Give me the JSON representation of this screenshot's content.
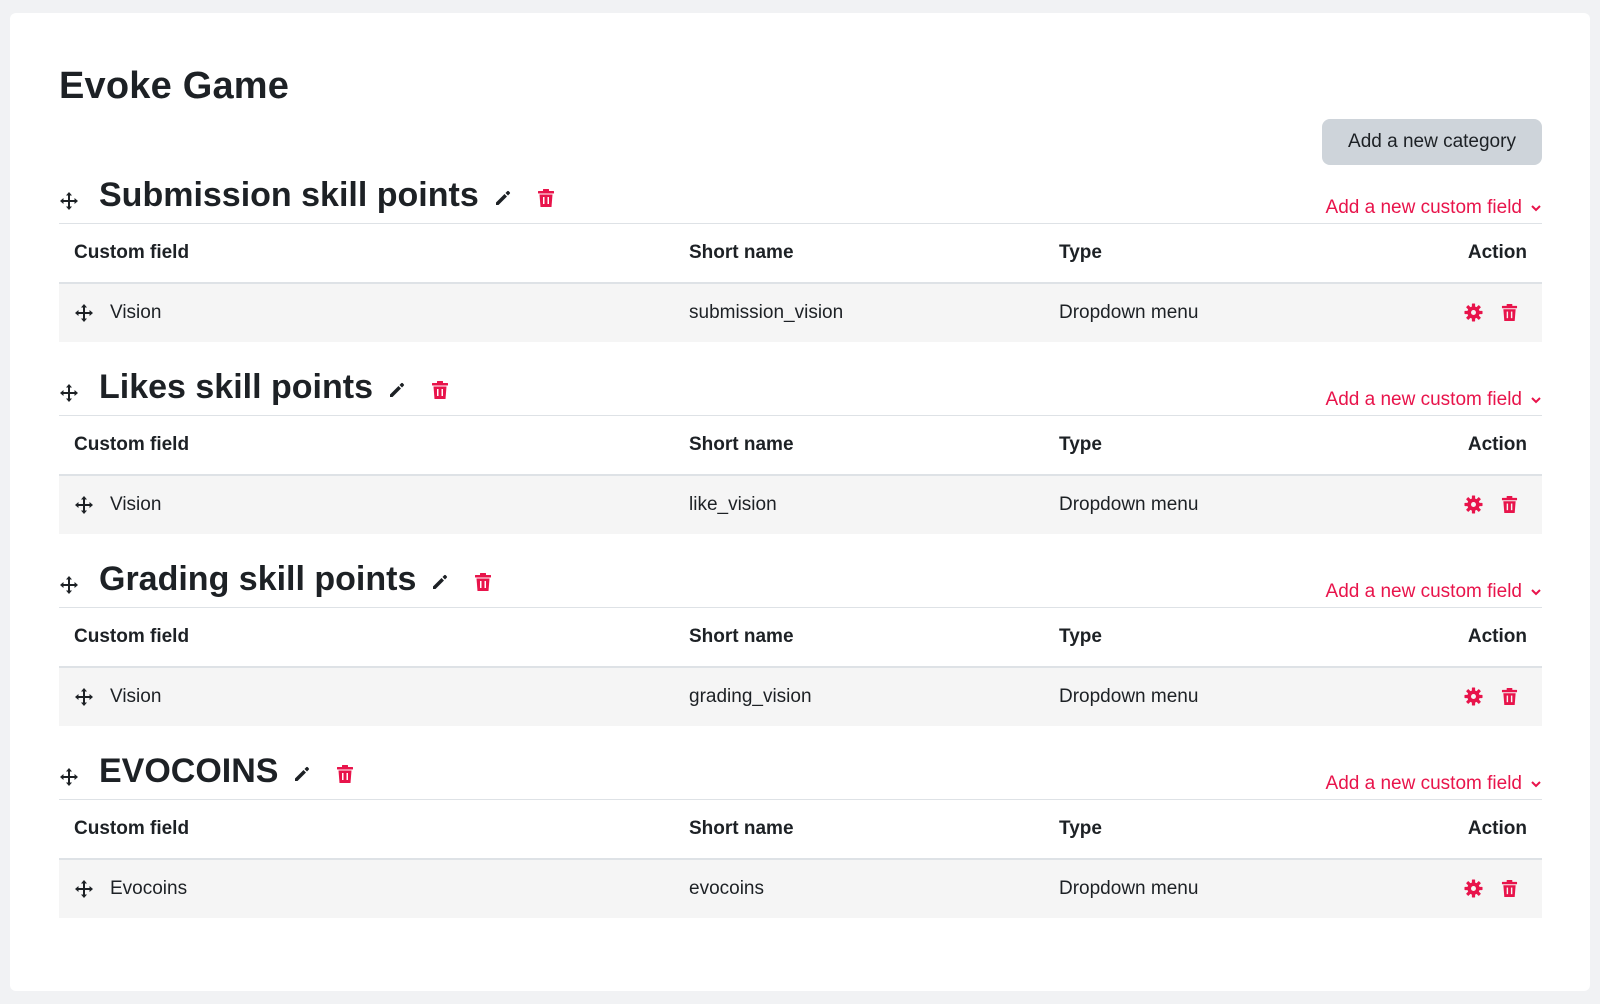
{
  "page": {
    "title": "Evoke Game"
  },
  "toolbar": {
    "add_category_label": "Add a new category"
  },
  "colors": {
    "accent": "#e8144b",
    "button_bg": "#ced4da",
    "row_bg": "#f5f5f5"
  },
  "table_headers": {
    "custom_field": "Custom field",
    "short_name": "Short name",
    "type": "Type",
    "action": "Action"
  },
  "categories": [
    {
      "name": "Submission skill points",
      "add_field_label": "Add a new custom field",
      "rows": [
        {
          "field": "Vision",
          "short_name": "submission_vision",
          "type": "Dropdown menu"
        }
      ]
    },
    {
      "name": "Likes skill points",
      "add_field_label": "Add a new custom field",
      "rows": [
        {
          "field": "Vision",
          "short_name": "like_vision",
          "type": "Dropdown menu"
        }
      ]
    },
    {
      "name": "Grading skill points",
      "add_field_label": "Add a new custom field",
      "rows": [
        {
          "field": "Vision",
          "short_name": "grading_vision",
          "type": "Dropdown menu"
        }
      ]
    },
    {
      "name": "EVOCOINS",
      "add_field_label": "Add a new custom field",
      "rows": [
        {
          "field": "Evocoins",
          "short_name": "evocoins",
          "type": "Dropdown menu"
        }
      ]
    }
  ]
}
